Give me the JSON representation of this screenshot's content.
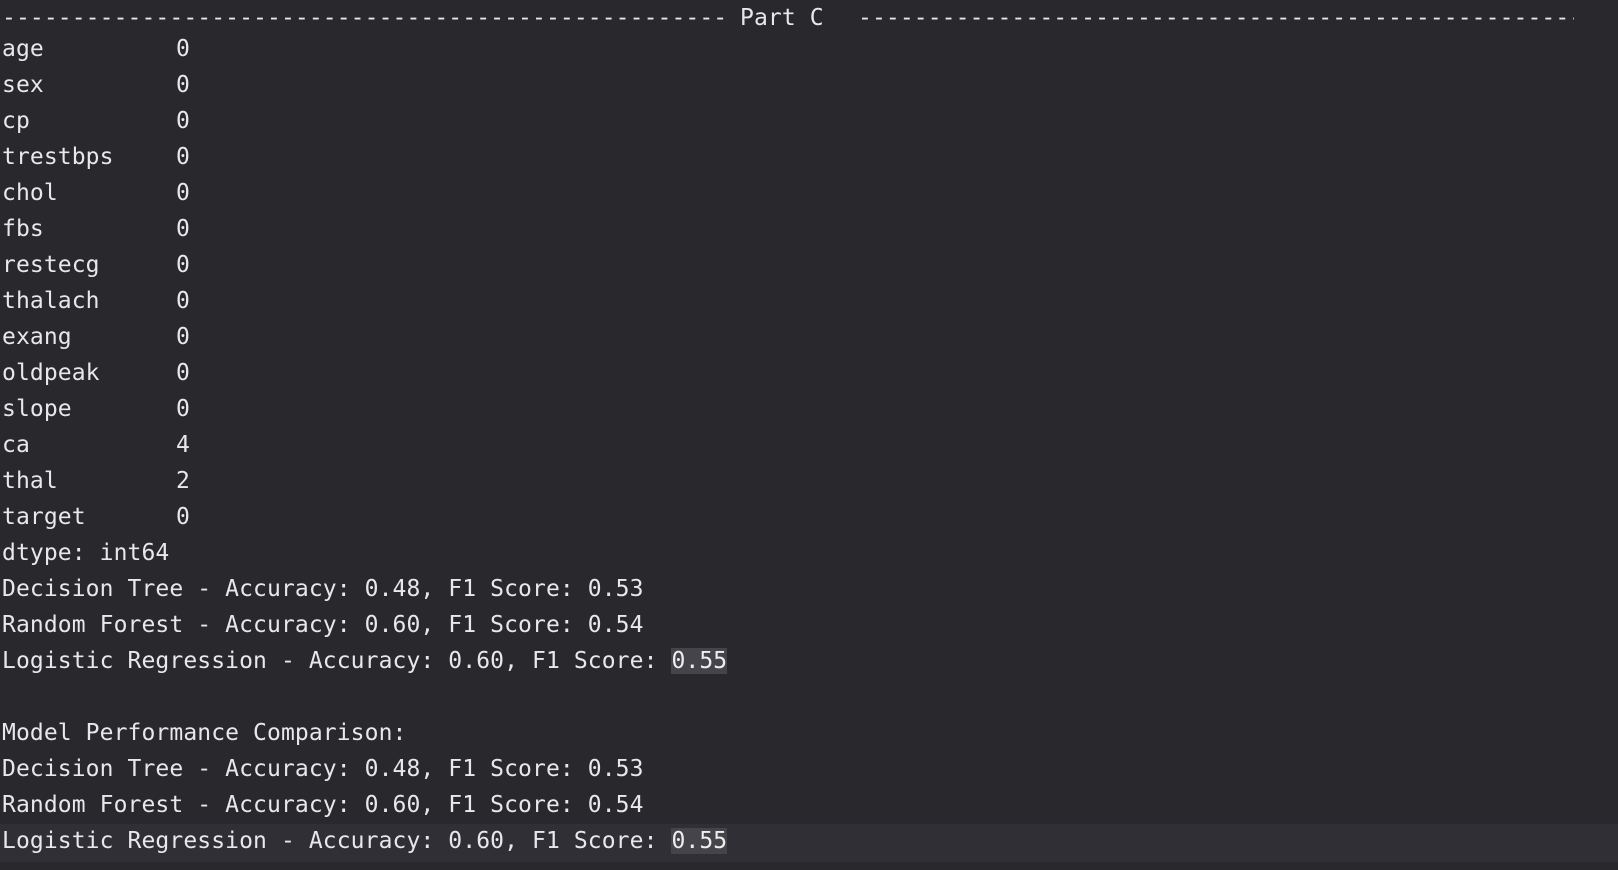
{
  "terminal": {
    "header": {
      "dashes_left": "--------------------------------------------------------------------------------------------------------",
      "label": "Part C",
      "dashes_right": "--------------------------------------------------------------------------------------------------------"
    },
    "missing_values": [
      {
        "feature": "age",
        "count": "0"
      },
      {
        "feature": "sex",
        "count": "0"
      },
      {
        "feature": "cp",
        "count": "0"
      },
      {
        "feature": "trestbps",
        "count": "0"
      },
      {
        "feature": "chol",
        "count": "0"
      },
      {
        "feature": "fbs",
        "count": "0"
      },
      {
        "feature": "restecg",
        "count": "0"
      },
      {
        "feature": "thalach",
        "count": "0"
      },
      {
        "feature": "exang",
        "count": "0"
      },
      {
        "feature": "oldpeak",
        "count": "0"
      },
      {
        "feature": "slope",
        "count": "0"
      },
      {
        "feature": "ca",
        "count": "4"
      },
      {
        "feature": "thal",
        "count": "2"
      },
      {
        "feature": "target",
        "count": "0"
      }
    ],
    "dtype_line": "dtype: int64",
    "results_first": [
      "Decision Tree - Accuracy: 0.48, F1 Score: 0.53",
      "Random Forest - Accuracy: 0.60, F1 Score: 0.54"
    ],
    "results_first_last": {
      "prefix": "Logistic Regression - Accuracy: 0.60, F1 Score: ",
      "value": "0.55"
    },
    "comparison_title": "Model Performance Comparison:",
    "results_second": [
      "Decision Tree - Accuracy: 0.48, F1 Score: 0.53",
      "Random Forest - Accuracy: 0.60, F1 Score: 0.54"
    ],
    "results_second_last": {
      "prefix": "Logistic Regression - Accuracy: 0.60, F1 Score: ",
      "value": "0.55"
    }
  }
}
